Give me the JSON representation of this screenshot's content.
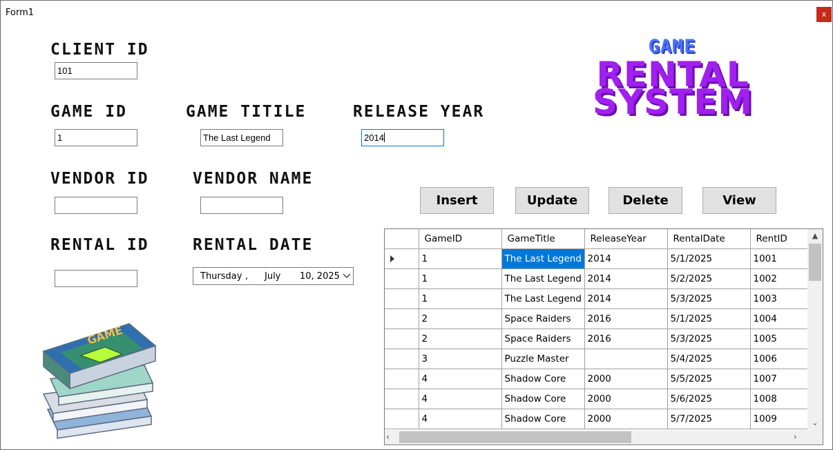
{
  "window": {
    "title": "Form1",
    "close_label": "x"
  },
  "labels": {
    "client_id": "CLiENT ID",
    "game_id": "GAME ID",
    "game_title": "GAME TiTiLE",
    "release_year": "RELEASE YEAR",
    "vendor_id": "VENDOR ID",
    "vendor_name": "VENDOR NAME",
    "rental_id": "RENTAL iD",
    "rental_date": "RENTAL DATE"
  },
  "fields": {
    "client_id": "101",
    "game_id": "1",
    "game_title": "The Last Legend",
    "release_year": "2014",
    "vendor_id": "",
    "vendor_name": "",
    "rental_id": ""
  },
  "date_picker": {
    "day": "Thursday",
    "sep": ",",
    "month": "July",
    "rest": "10, 2025"
  },
  "buttons": {
    "insert": "Insert",
    "update": "Update",
    "delete": "Delete",
    "view": "View"
  },
  "logo": {
    "line1": "GAME",
    "line2": "RENTAL",
    "line3": "SYSTEM"
  },
  "grid": {
    "columns": [
      "GameID",
      "GameTitle",
      "ReleaseYear",
      "RentalDate",
      "RentID"
    ],
    "rows": [
      [
        "1",
        "The Last Legend",
        "2014",
        "5/1/2025",
        "1001"
      ],
      [
        "1",
        "The Last Legend",
        "2014",
        "5/2/2025",
        "1002"
      ],
      [
        "1",
        "The Last Legend",
        "2014",
        "5/3/2025",
        "1003"
      ],
      [
        "2",
        "Space Raiders",
        "2016",
        "5/1/2025",
        "1004"
      ],
      [
        "2",
        "Space Raiders",
        "2016",
        "5/3/2025",
        "1005"
      ],
      [
        "3",
        "Puzzle Master",
        "",
        "5/4/2025",
        "1006"
      ],
      [
        "4",
        "Shadow Core",
        "2000",
        "5/5/2025",
        "1007"
      ],
      [
        "4",
        "Shadow Core",
        "2000",
        "5/6/2025",
        "1008"
      ],
      [
        "4",
        "Shadow Core",
        "2000",
        "5/7/2025",
        "1009"
      ]
    ],
    "selected_row": 0,
    "selected_col": 1
  },
  "image": {
    "cover_text": "GAME"
  },
  "colors": {
    "accent": "#0078d7",
    "logo_purple": "#a020f0",
    "logo_blue": "#4a73ff",
    "close_red": "#c42b1c"
  }
}
